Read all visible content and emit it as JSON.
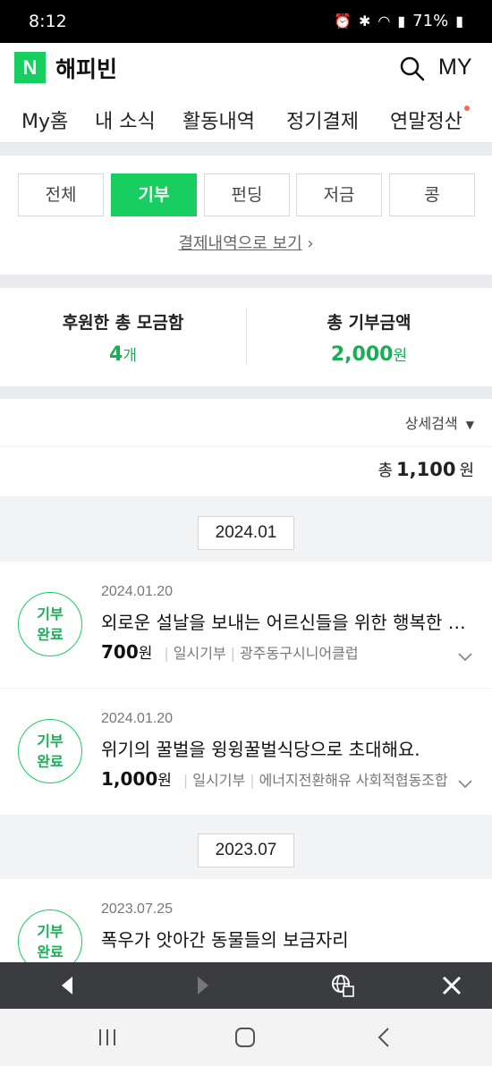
{
  "status": {
    "time": "8:12",
    "battery": "71%"
  },
  "header": {
    "logo_letter": "N",
    "app_name": "해피빈",
    "my_label": "MY"
  },
  "tabs": [
    {
      "label": "My홈"
    },
    {
      "label": "내 소식"
    },
    {
      "label": "활동내역",
      "active": true
    },
    {
      "label": "정기결제"
    },
    {
      "label": "연말정산",
      "has_dot": true
    }
  ],
  "filter": {
    "buttons": [
      "전체",
      "기부",
      "펀딩",
      "저금",
      "콩"
    ],
    "selected": "기부",
    "receipt_link": "결제내역으로 보기"
  },
  "summary": {
    "left": {
      "label": "후원한 총 모금함",
      "value": "4",
      "unit": "개"
    },
    "right": {
      "label": "총 기부금액",
      "value": "2,000",
      "unit": "원"
    }
  },
  "detail_search": "상세검색",
  "total": {
    "prefix": "총",
    "amount": "1,100",
    "unit": "원"
  },
  "groups": [
    {
      "month": "2024.01",
      "items": [
        {
          "badge_line1": "기부",
          "badge_line2": "완료",
          "date": "2024.01.20",
          "title": "외로운 설날을 보내는 어르신들을 위한 행복한 명절",
          "amount": "700",
          "unit": "원",
          "type": "일시기부",
          "org": "광주동구시니어클럽"
        },
        {
          "badge_line1": "기부",
          "badge_line2": "완료",
          "date": "2024.01.20",
          "title": "위기의 꿀벌을 윙윙꿀벌식당으로 초대해요.",
          "amount": "1,000",
          "unit": "원",
          "type": "일시기부",
          "org": "에너지전환해유 사회적협동조합"
        }
      ]
    },
    {
      "month": "2023.07",
      "items": [
        {
          "badge_line1": "기부",
          "badge_line2": "완료",
          "date": "2023.07.25",
          "title": "폭우가 앗아간 동물들의 보금자리"
        }
      ]
    }
  ],
  "colors": {
    "accent": "#19ce60",
    "accent_text": "#19ae55",
    "toolbar": "#3a3c40"
  }
}
